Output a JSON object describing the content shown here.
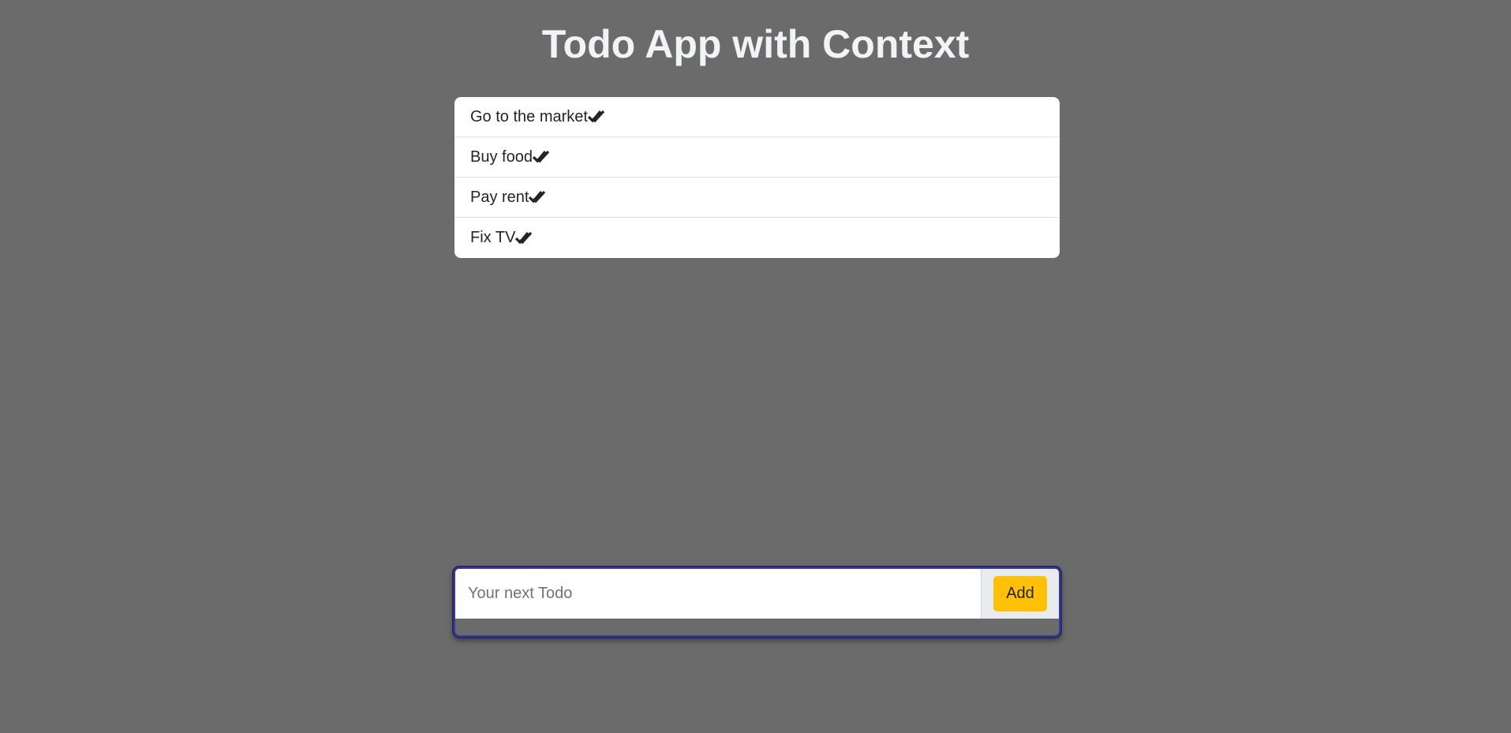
{
  "app": {
    "title": "Todo App with Context"
  },
  "todos": [
    {
      "text": "Go to the market",
      "icon": "double-check-icon"
    },
    {
      "text": "Buy food",
      "icon": "double-check-icon"
    },
    {
      "text": "Pay rent",
      "icon": "double-check-icon"
    },
    {
      "text": "Fix TV",
      "icon": "double-check-icon"
    }
  ],
  "form": {
    "input_value": "",
    "input_placeholder": "Your next Todo",
    "add_label": "Add"
  },
  "colors": {
    "background": "#6b6b6b",
    "add_button": "#ffc107",
    "focus_border": "#3b38a8"
  }
}
